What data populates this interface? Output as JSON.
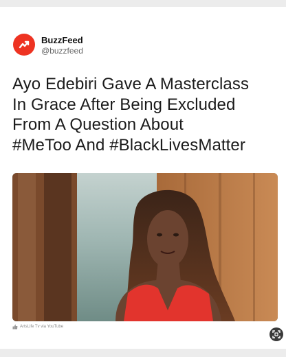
{
  "post": {
    "publisher_name": "BuzzFeed",
    "handle": "@buzzfeed",
    "headline_lines": [
      "Ayo Edebiri Gave A Masterclass",
      "In Grace After Being Excluded",
      "From A Question About",
      "#MeToo And #BlackLivesMatter"
    ],
    "image_credit": "ArtsLife Tv via YouTube"
  },
  "icons": {
    "avatar": "buzzfeed-trending-arrow-icon",
    "credit": "thumbs-up-icon",
    "expand": "expand-icon"
  },
  "colors": {
    "brand": "#ee3322",
    "headline": "#1b1b1b",
    "page_background": "#ececec"
  }
}
